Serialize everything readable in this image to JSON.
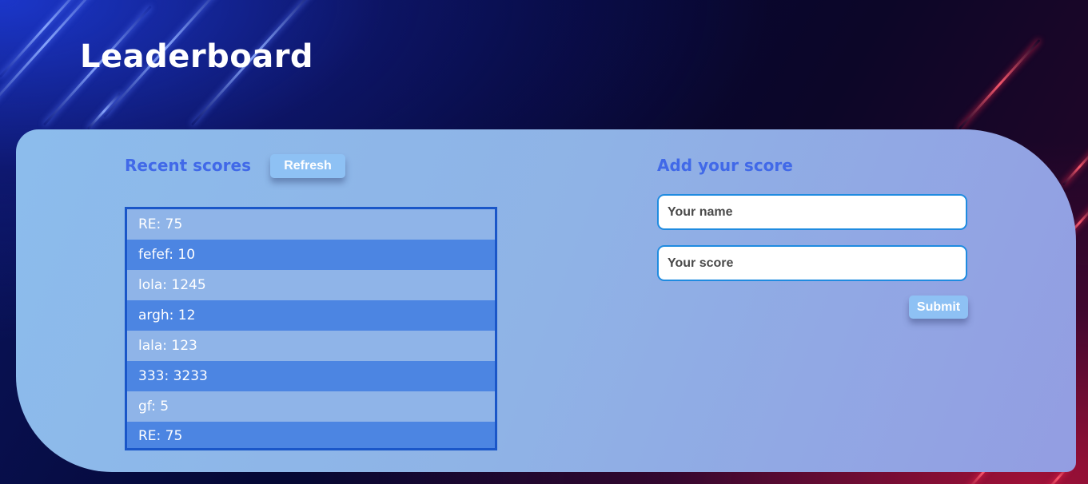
{
  "header": {
    "title": "Leaderboard"
  },
  "recent": {
    "title": "Recent scores",
    "refresh_label": "Refresh",
    "scores": [
      "RE: 75",
      "fefef: 10",
      "lola: 1245",
      "argh: 12",
      "lala: 123",
      "333: 3233",
      "gf: 5",
      "RE: 75"
    ]
  },
  "add": {
    "title": "Add your score",
    "name_placeholder": "Your name",
    "score_placeholder": "Your score",
    "submit_label": "Submit"
  },
  "colors": {
    "accent": "#4169e8",
    "button": "#8ec1f4",
    "row_light": "#8fb4e8",
    "row_dark": "#4c85e2",
    "list_border": "#1a56c8",
    "input_border": "#1f8be0"
  }
}
